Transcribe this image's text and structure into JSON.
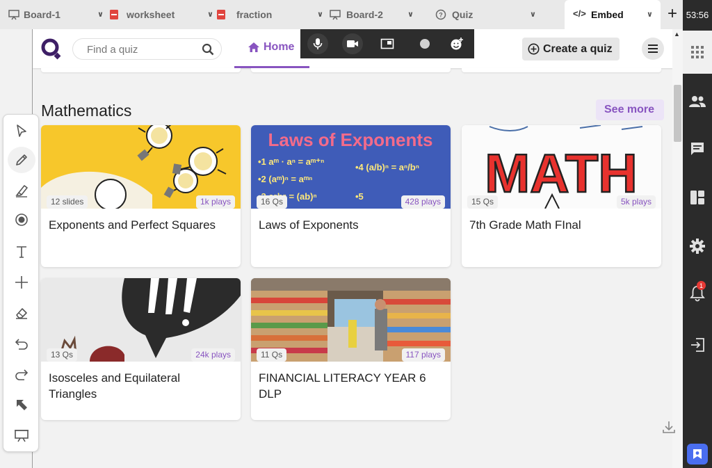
{
  "tabs": [
    {
      "label": "Board-1",
      "icon": "board-icon",
      "active": false
    },
    {
      "label": "worksheet",
      "icon": "pdf-icon",
      "active": false
    },
    {
      "label": "fraction",
      "icon": "pdf-icon",
      "active": false
    },
    {
      "label": "Board-2",
      "icon": "board-icon",
      "active": false
    },
    {
      "label": "Quiz",
      "icon": "help-icon",
      "active": false
    },
    {
      "label": "Embed",
      "icon": "code-icon",
      "active": true
    }
  ],
  "clock": "53:56",
  "notification_count": "1",
  "header": {
    "search_placeholder": "Find a quiz",
    "home_label": "Home",
    "create_label": "Create a quiz"
  },
  "section": {
    "title": "Mathematics",
    "see_more": "See more"
  },
  "cards": [
    {
      "title": "Exponents and Perfect Squares",
      "count": "12 slides",
      "plays": "1k plays"
    },
    {
      "title": "Laws of Exponents",
      "count": "16 Qs",
      "plays": "428 plays"
    },
    {
      "title": "7th Grade Math FInal",
      "count": "15 Qs",
      "plays": "5k plays"
    },
    {
      "title": "Isosceles and Equilateral Triangles",
      "count": "13 Qs",
      "plays": "24k plays"
    },
    {
      "title": "FINANCIAL LITERACY YEAR 6 DLP",
      "count": "11 Qs",
      "plays": "117 plays"
    }
  ],
  "thumbs": {
    "exponents_heading": "Laws of Exponents",
    "exp_rule_1": "•1  aᵐ · aⁿ = aᵐ⁺ⁿ",
    "exp_rule_2": "•2  (aᵐ)ⁿ = aᵐⁿ",
    "exp_rule_3": "•3  aⁿbⁿ = (ab)ⁿ",
    "exp_rule_4": "•4  (a/b)ⁿ = aⁿ/bⁿ",
    "exp_rule_5": "•5",
    "math_word": "MATH"
  },
  "colors": {
    "brand": "#8854c0",
    "sidebar": "#2b2b2b",
    "badge": "#e53935"
  },
  "toolbar": [
    "select-tool",
    "pen-tool",
    "highlighter-tool",
    "laser-tool",
    "text-tool",
    "add-tool",
    "eraser-tool",
    "undo-tool",
    "redo-tool",
    "pointer-tool",
    "present-tool"
  ]
}
